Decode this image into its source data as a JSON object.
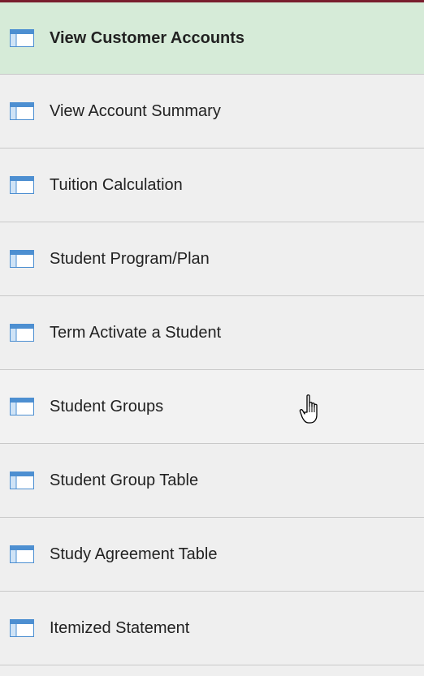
{
  "menu": {
    "items": [
      {
        "label": "View Customer Accounts",
        "icon": "table-icon",
        "selected": true
      },
      {
        "label": "View Account Summary",
        "icon": "table-icon",
        "selected": false
      },
      {
        "label": "Tuition Calculation",
        "icon": "table-icon",
        "selected": false
      },
      {
        "label": "Student Program/Plan",
        "icon": "table-icon",
        "selected": false
      },
      {
        "label": "Term Activate a Student",
        "icon": "table-icon",
        "selected": false
      },
      {
        "label": "Student Groups",
        "icon": "table-icon",
        "selected": false
      },
      {
        "label": "Student Group Table",
        "icon": "table-icon",
        "selected": false
      },
      {
        "label": "Study Agreement Table",
        "icon": "table-icon",
        "selected": false
      },
      {
        "label": "Itemized Statement",
        "icon": "table-icon",
        "selected": false
      }
    ]
  },
  "colors": {
    "selected_bg": "#d6ebd8",
    "item_bg": "#efefef",
    "top_border": "#7a1e2e",
    "divider": "#c9c9c9",
    "icon_blue": "#4d8fd1"
  },
  "cursor": {
    "icon": "hand-pointer-icon"
  }
}
